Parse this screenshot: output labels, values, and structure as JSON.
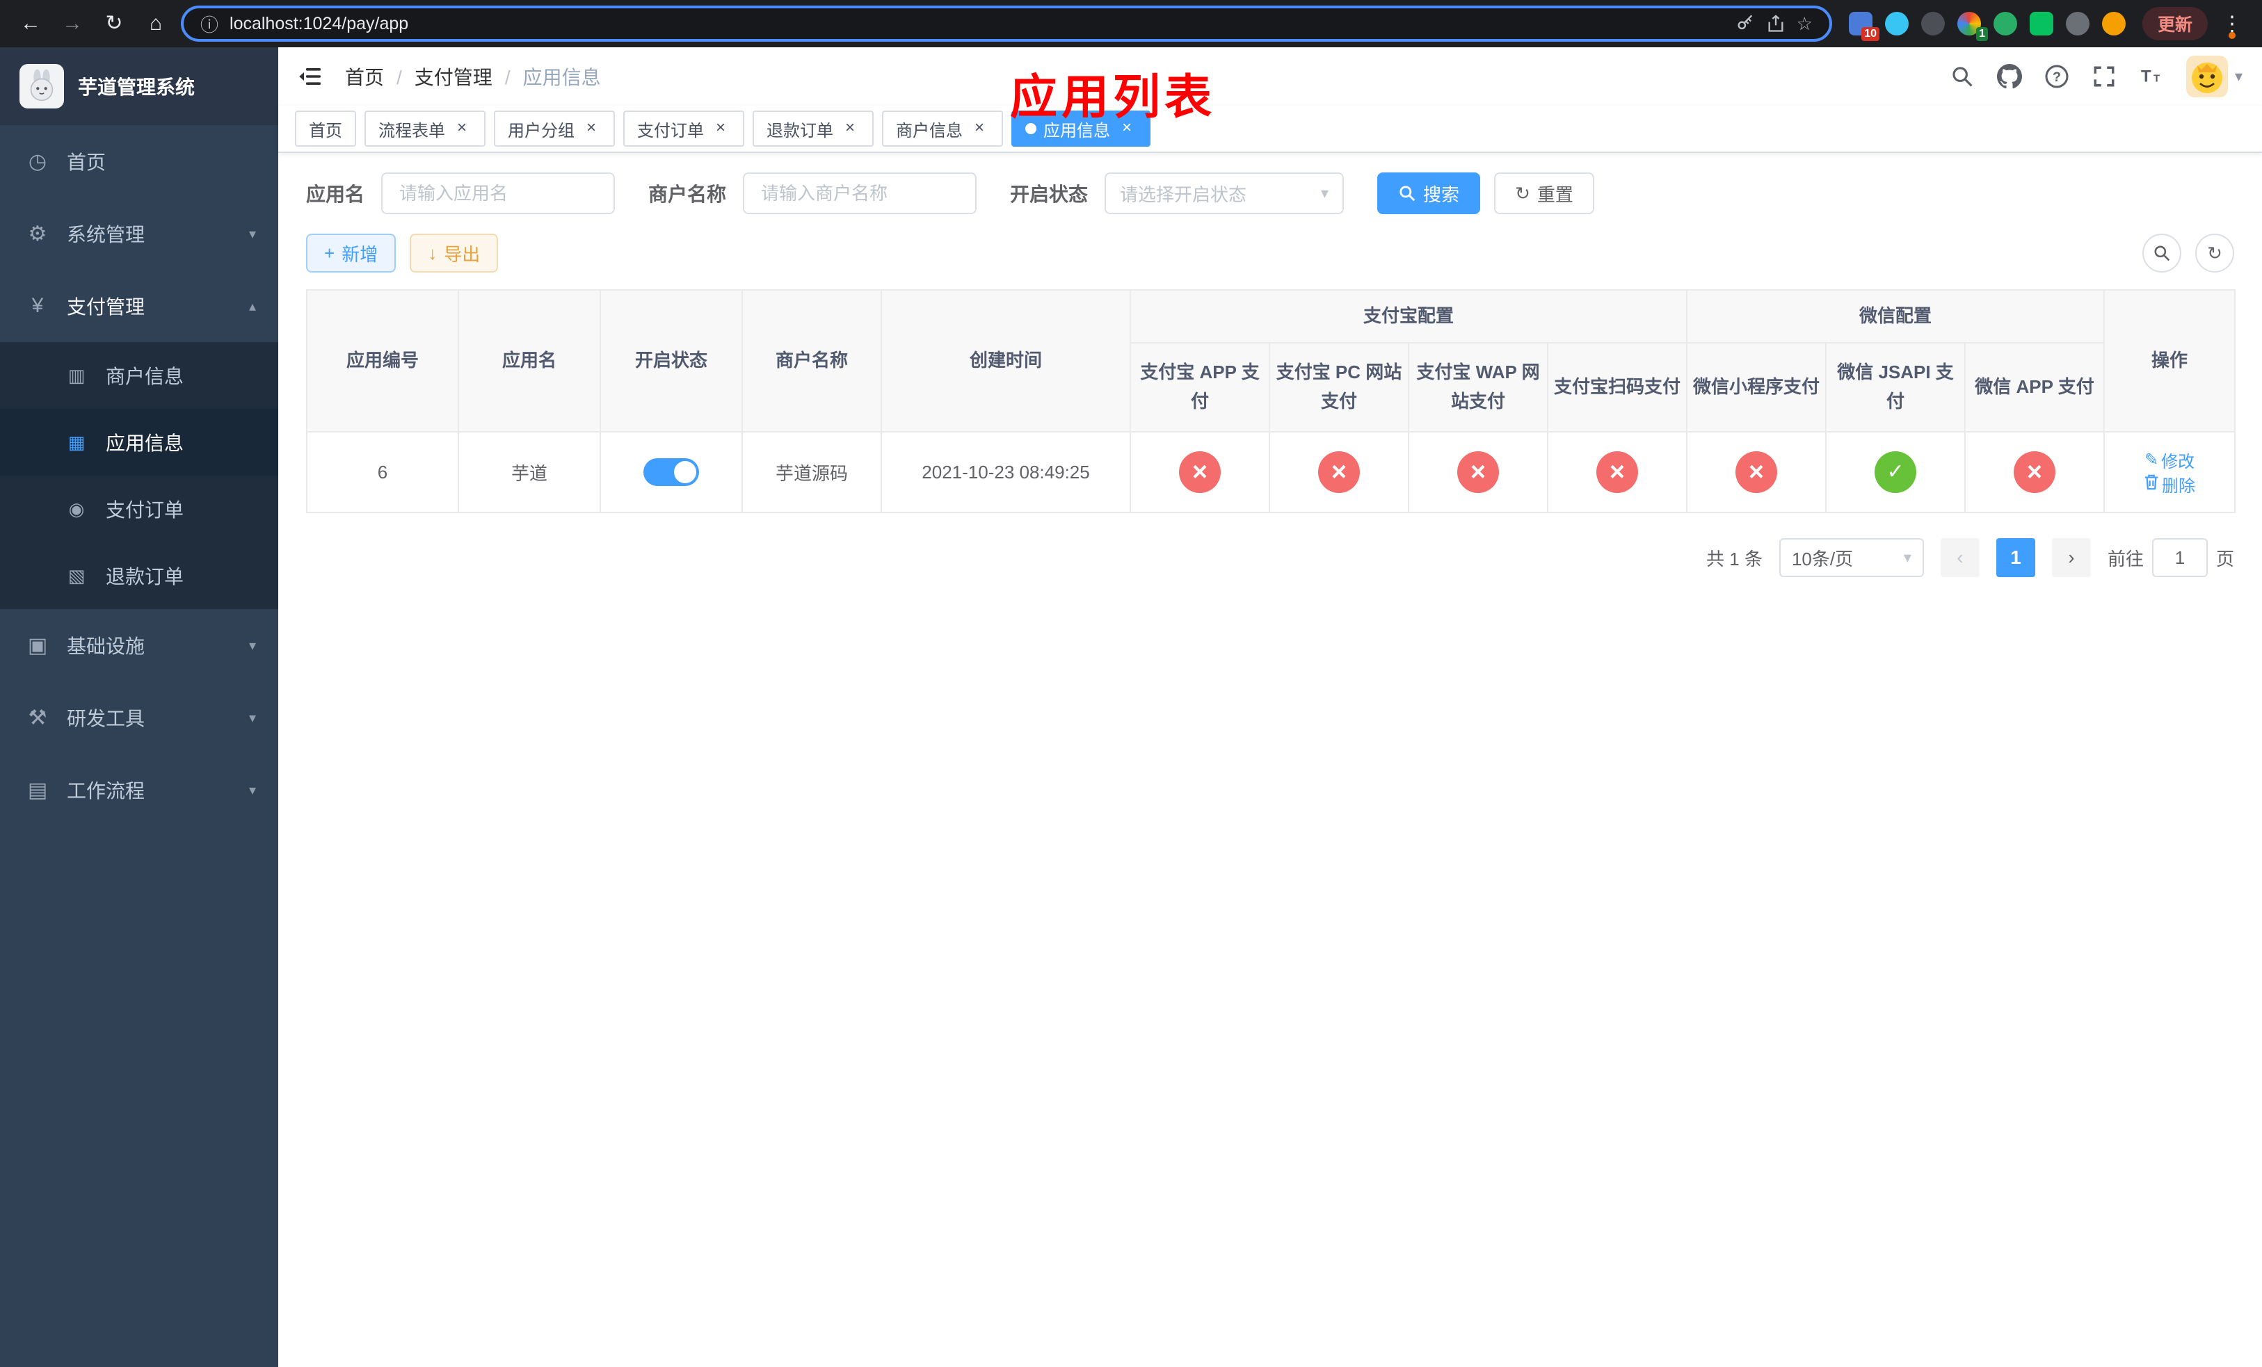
{
  "browser": {
    "url": "localhost:1024/pay/app",
    "update_label": "更新",
    "extension_badge_count": "10",
    "extension_badge_count2": "1"
  },
  "icons": {
    "back": "←",
    "forward": "→",
    "reload": "↻",
    "home": "⌂",
    "info": "ⓘ",
    "star": "☆",
    "kebab": "⋮",
    "dashboard": "◷",
    "gear": "⚙",
    "yen": "¥",
    "infra": "▣",
    "tools": "⚒",
    "workflow": "▤",
    "merchant": "▥",
    "app": "▦",
    "order": "◉",
    "refund": "▧",
    "caret_down": "▾",
    "caret_up": "▴",
    "plus": "+",
    "download": "↓",
    "refresh": "↻",
    "edit": "✎",
    "prev": "‹",
    "next": "›",
    "close": "×"
  },
  "sidebar": {
    "app_title": "芋道管理系统",
    "items": [
      {
        "label": "首页"
      },
      {
        "label": "系统管理"
      },
      {
        "label": "支付管理",
        "children": [
          {
            "label": "商户信息"
          },
          {
            "label": "应用信息",
            "active": true
          },
          {
            "label": "支付订单"
          },
          {
            "label": "退款订单"
          }
        ]
      },
      {
        "label": "基础设施"
      },
      {
        "label": "研发工具"
      },
      {
        "label": "工作流程"
      }
    ]
  },
  "header": {
    "breadcrumb": [
      "首页",
      "支付管理",
      "应用信息"
    ],
    "overlay_title": "应用列表"
  },
  "tabs": [
    {
      "label": "首页"
    },
    {
      "label": "流程表单"
    },
    {
      "label": "用户分组"
    },
    {
      "label": "支付订单"
    },
    {
      "label": "退款订单"
    },
    {
      "label": "商户信息"
    },
    {
      "label": "应用信息",
      "active": true
    }
  ],
  "filters": {
    "app_name_label": "应用名",
    "app_name_placeholder": "请输入应用名",
    "merchant_label": "商户名称",
    "merchant_placeholder": "请输入商户名称",
    "status_label": "开启状态",
    "status_placeholder": "请选择开启状态",
    "search_label": "搜索",
    "reset_label": "重置"
  },
  "toolbar": {
    "add_label": "新增",
    "export_label": "导出"
  },
  "table": {
    "columns": {
      "id": "应用编号",
      "name": "应用名",
      "status": "开启状态",
      "merchant": "商户名称",
      "created": "创建时间",
      "actions": "操作"
    },
    "groups": {
      "alipay": "支付宝配置",
      "wechat": "微信配置"
    },
    "alipay_cols": [
      "支付宝 APP 支付",
      "支付宝 PC 网站支付",
      "支付宝 WAP 网站支付",
      "支付宝扫码支付"
    ],
    "wechat_cols": [
      "微信小程序支付",
      "微信 JSAPI 支付",
      "微信 APP 支付"
    ],
    "rows": [
      {
        "id": "6",
        "name": "芋道",
        "status": "on",
        "merchant": "芋道源码",
        "created": "2021-10-23 08:49:25",
        "channels": [
          "no",
          "no",
          "no",
          "no",
          "no",
          "yes",
          "no"
        ],
        "edit": "修改",
        "delete": "删除"
      }
    ]
  },
  "pagination": {
    "total": "共 1 条",
    "page_size": "10条/页",
    "page": "1",
    "goto_label": "前往",
    "goto_value": "1",
    "goto_unit": "页"
  }
}
